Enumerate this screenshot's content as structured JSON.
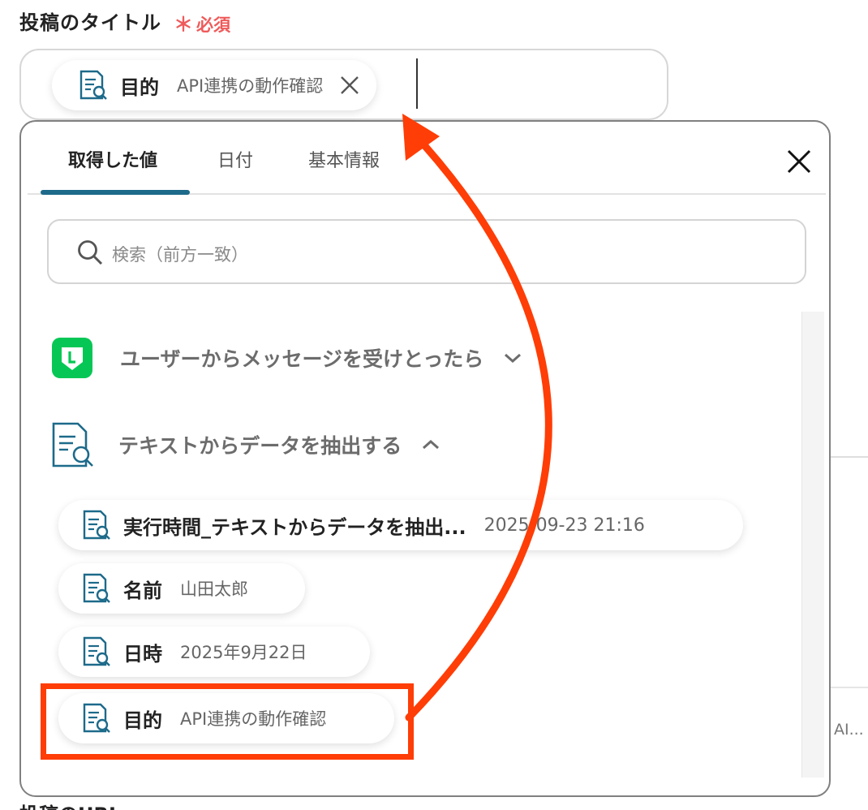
{
  "field": {
    "label": "投稿のタイトル",
    "required_mark": "＊",
    "required_text": "必須",
    "current_token": {
      "name": "目的",
      "value": "API連携の動作確認"
    }
  },
  "popover": {
    "tabs": [
      {
        "label": "取得した値",
        "active": true
      },
      {
        "label": "日付",
        "active": false
      },
      {
        "label": "基本情報",
        "active": false
      }
    ],
    "search_placeholder": "検索（前方一致）",
    "sections": [
      {
        "label": "ユーザーからメッセージを受けとったら",
        "icon": "line-app-icon",
        "expanded": false
      },
      {
        "label": "テキストからデータを抽出する",
        "icon": "document-search-icon",
        "expanded": true
      }
    ],
    "items": [
      {
        "name": "実行時間_テキストからデータを抽出...",
        "value": "2025-09-23 21:16"
      },
      {
        "name": "名前",
        "value": "山田太郎"
      },
      {
        "name": "日時",
        "value": "2025年9月22日"
      },
      {
        "name": "目的",
        "value": "API連携の動作確認"
      }
    ]
  },
  "background": {
    "truncated_text": "AI...",
    "next_field_label": "投稿のURL"
  },
  "colors": {
    "accent": "#1d6a8a",
    "required": "#ef5a5a",
    "annotation": "#ff3d06",
    "line_green": "#06c755"
  }
}
